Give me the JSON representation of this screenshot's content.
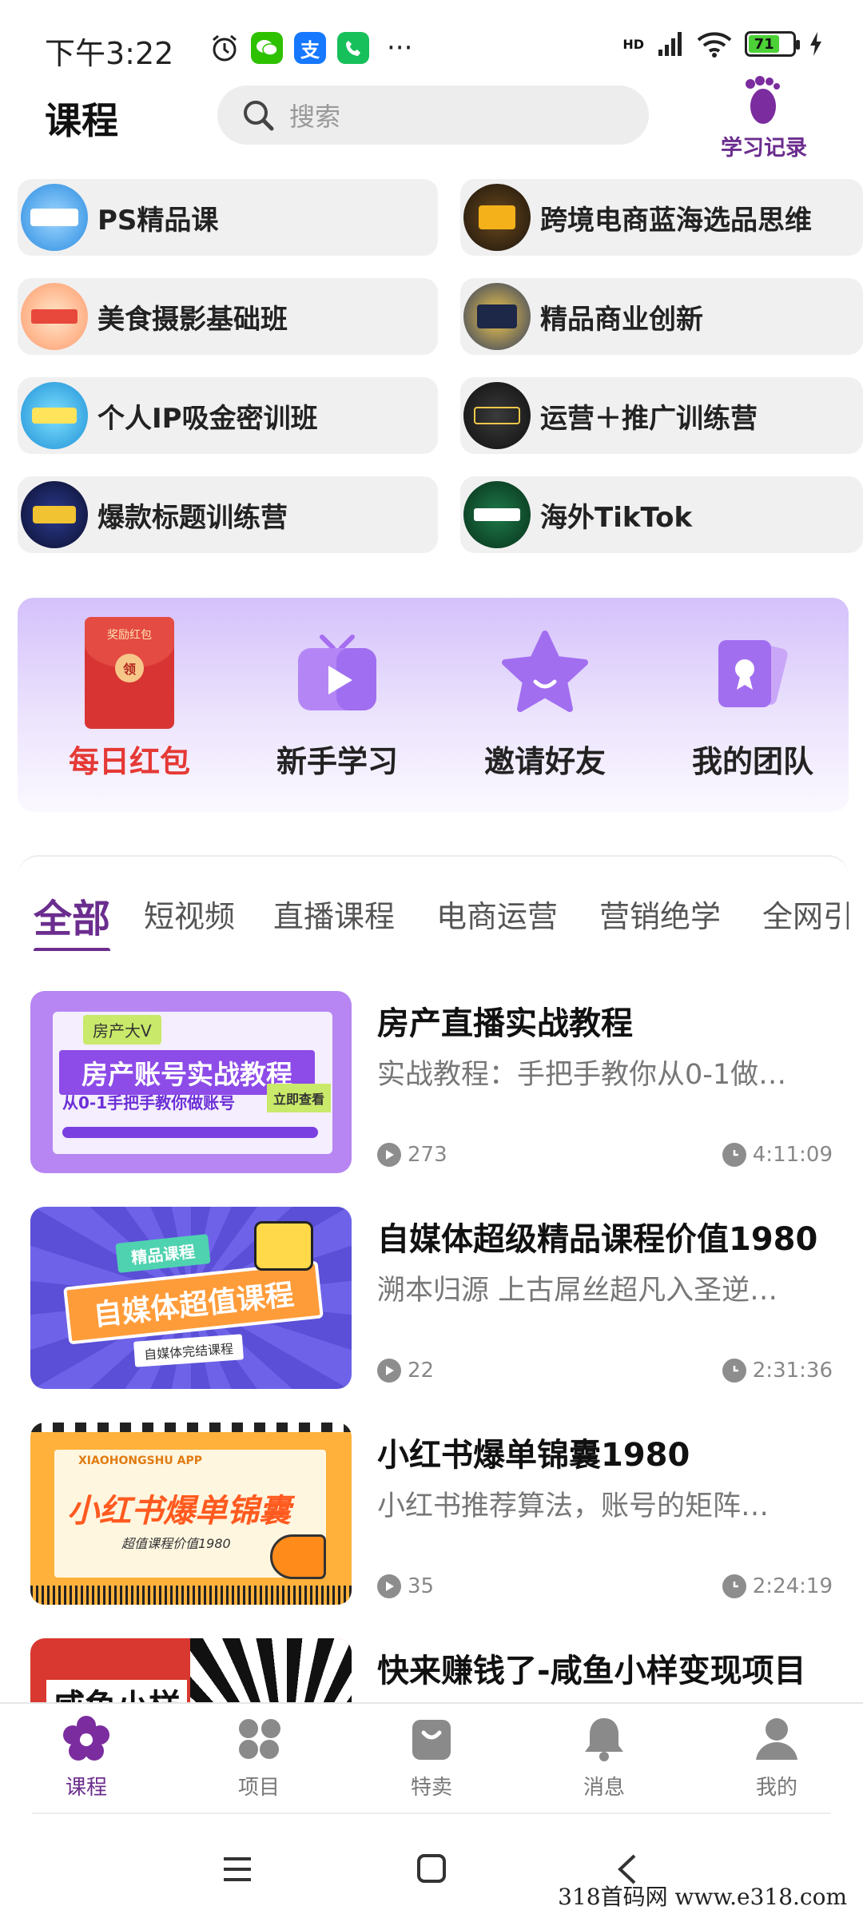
{
  "status_bar": {
    "time": "下午3:22",
    "network": "HD",
    "battery": "71"
  },
  "header": {
    "title": "课程",
    "search_placeholder": "搜索",
    "history_label": "学习记录"
  },
  "courses": [
    {
      "name": "PS精品课"
    },
    {
      "name": "跨境电商蓝海选品思维"
    },
    {
      "name": "美食摄影基础班"
    },
    {
      "name": "精品商业创新"
    },
    {
      "name": "个人IP吸金密训班"
    },
    {
      "name": "运营＋推广训练营"
    },
    {
      "name": "爆款标题训练营"
    },
    {
      "name": "海外TikTok"
    }
  ],
  "features": [
    {
      "label": "每日红包",
      "badge_top": "奖励红包",
      "badge_coin": "领"
    },
    {
      "label": "新手学习"
    },
    {
      "label": "邀请好友"
    },
    {
      "label": "我的团队"
    }
  ],
  "tabs": [
    "全部",
    "短视频",
    "直播课程",
    "电商运营",
    "营销绝学",
    "全网引"
  ],
  "list": [
    {
      "title": "房产直播实战教程",
      "desc": "实战教程：手把手教你从0-1做…",
      "views": "273",
      "duration": "4:11:09",
      "thumb": {
        "tag": "房产大V",
        "headline": "房产账号实战教程",
        "sub": "从0-1手把手教你做账号",
        "btn": "立即查看"
      }
    },
    {
      "title": "自媒体超级精品课程价值1980",
      "desc": "溯本归源 上古屌丝超凡入圣逆…",
      "views": "22",
      "duration": "2:31:36",
      "thumb": {
        "tag": "精品课程",
        "headline": "自媒体超值课程",
        "sub": "自媒体完结课程"
      }
    },
    {
      "title": "小红书爆单锦囊1980",
      "desc": "小红书推荐算法，账号的矩阵…",
      "views": "35",
      "duration": "2:24:19",
      "thumb": {
        "tag": "XIAOHONGSHU APP",
        "headline": "小红书爆单锦囊",
        "sub": "超值课程价值1980"
      }
    },
    {
      "title": "快来赚钱了-咸鱼小样变现项目",
      "desc": "",
      "views": "",
      "duration": "",
      "thumb": {
        "headline": "咸鱼小样"
      }
    }
  ],
  "bottom_nav": [
    {
      "label": "课程",
      "icon": "flower-icon",
      "active": true
    },
    {
      "label": "项目",
      "icon": "grid-icon"
    },
    {
      "label": "特卖",
      "icon": "bag-icon"
    },
    {
      "label": "消息",
      "icon": "bell-icon"
    },
    {
      "label": "我的",
      "icon": "person-icon"
    }
  ],
  "watermark": "318首码网  www.e318.com",
  "colors": {
    "accent": "#6b2d8e",
    "red": "#e53935"
  }
}
